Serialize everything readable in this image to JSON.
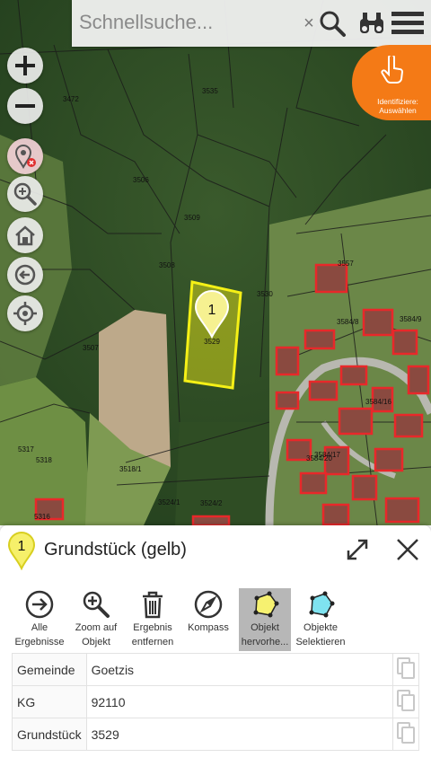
{
  "search": {
    "placeholder": "Schnellsuche...",
    "clear_symbol": "×"
  },
  "identify_button": {
    "label": "Identifiziere: Auswählen"
  },
  "map": {
    "parcel_labels": [
      "3472",
      "3535",
      "3506",
      "3509",
      "3508",
      "3507",
      "3530",
      "3557",
      "3584/8",
      "3584/9",
      "3584/16",
      "3584/17",
      "3584/20",
      "3518/1",
      "3524/1",
      "3524/2",
      "5317",
      "5318",
      "5316"
    ],
    "marker": {
      "number": "1",
      "parcel": "3529"
    },
    "colors": {
      "selection": "#f5f016",
      "buildings": "#e8282a"
    }
  },
  "panel": {
    "marker_number": "1",
    "title": "Grundstück (gelb)",
    "toolbar": [
      {
        "line1": "Alle",
        "line2": "Ergebnisse",
        "icon": "arrow-right-circle"
      },
      {
        "line1": "Zoom auf",
        "line2": "Objekt",
        "icon": "zoom-in"
      },
      {
        "line1": "Ergebnis",
        "line2": "entfernen",
        "icon": "trash"
      },
      {
        "line1": "Kompass",
        "line2": "",
        "icon": "compass"
      },
      {
        "line1": "Objekt",
        "line2": "hervorhe...",
        "icon": "highlight-polygon",
        "active": true
      },
      {
        "line1": "Objekte",
        "line2": "Selektieren",
        "icon": "select-polygon"
      }
    ],
    "attributes": [
      {
        "key": "Gemeinde",
        "value": "Goetzis"
      },
      {
        "key": "KG",
        "value": "92110"
      },
      {
        "key": "Grundstück",
        "value": "3529"
      }
    ]
  }
}
